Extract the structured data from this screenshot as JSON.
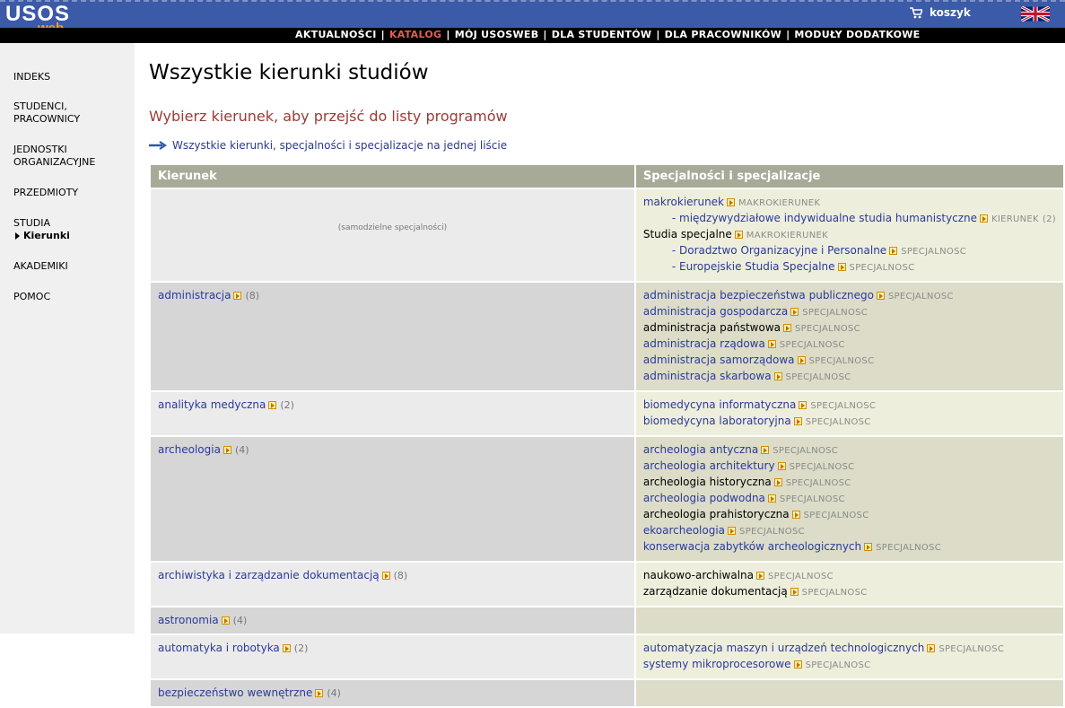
{
  "header": {
    "logo_main": "USOS",
    "logo_sub": "web",
    "cart_label": "koszyk",
    "menu": [
      {
        "label": "AKTUALNOŚCI",
        "active": false
      },
      {
        "label": "KATALOG",
        "active": true
      },
      {
        "label": "MÓJ USOSWEB",
        "active": false
      },
      {
        "label": "DLA STUDENTÓW",
        "active": false
      },
      {
        "label": "DLA PRACOWNIKÓW",
        "active": false
      },
      {
        "label": "MODUŁY DODATKOWE",
        "active": false
      }
    ],
    "menu_separator": "|"
  },
  "sidebar": {
    "items": [
      {
        "label": "INDEKS"
      },
      {
        "label": "STUDENCI,\nPRACOWNICY"
      },
      {
        "label": "JEDNOSTKI\nORGANIZACYJNE"
      },
      {
        "label": "PRZEDMIOTY"
      },
      {
        "label": "STUDIA"
      },
      {
        "label": "AKADEMIKI"
      },
      {
        "label": "POMOC"
      }
    ],
    "sub_item": "Kierunki"
  },
  "main": {
    "title": "Wszystkie kierunki studiów",
    "subtitle": "Wybierz kierunek, aby przejść do listy programów",
    "all_link": "Wszystkie kierunki, specjalności i specjalizacje na jednej liście",
    "table": {
      "headers": [
        "Kierunek",
        "Specjalności i specjalizacje"
      ],
      "rows": [
        {
          "kierunek": "",
          "note": "(samodzielne specjalności)",
          "count": "",
          "specs": [
            {
              "name": "makrokierunek",
              "link": true,
              "tag": "MAKROKIERUNEK",
              "indent": false,
              "extra": ""
            },
            {
              "name": "- międzywydziałowe indywidualne studia humanistyczne",
              "link": true,
              "tag": "KIERUNEK",
              "indent": true,
              "extra": "(2)"
            },
            {
              "name": "Studia specjalne",
              "link": false,
              "tag": "MAKROKIERUNEK",
              "indent": false,
              "extra": ""
            },
            {
              "name": "- Doradztwo Organizacyjne i Personalne",
              "link": true,
              "tag": "SPECJALNOSC",
              "indent": true,
              "extra": ""
            },
            {
              "name": "- Europejskie Studia Specjalne",
              "link": true,
              "tag": "SPECJALNOSC",
              "indent": true,
              "extra": ""
            }
          ]
        },
        {
          "kierunek": "administracja",
          "count": "(8)",
          "note": "",
          "specs": [
            {
              "name": "administracja bezpieczeństwa publicznego",
              "link": true,
              "tag": "SPECJALNOSC"
            },
            {
              "name": "administracja gospodarcza",
              "link": true,
              "tag": "SPECJALNOSC"
            },
            {
              "name": "administracja państwowa",
              "link": false,
              "tag": "SPECJALNOSC"
            },
            {
              "name": "administracja rządowa",
              "link": true,
              "tag": "SPECJALNOSC"
            },
            {
              "name": "administracja samorządowa",
              "link": true,
              "tag": "SPECJALNOSC"
            },
            {
              "name": "administracja skarbowa",
              "link": true,
              "tag": "SPECJALNOSC"
            }
          ]
        },
        {
          "kierunek": "analityka medyczna",
          "count": "(2)",
          "note": "",
          "specs": [
            {
              "name": "biomedycyna informatyczna",
              "link": true,
              "tag": "SPECJALNOSC"
            },
            {
              "name": "biomedycyna laboratoryjna",
              "link": true,
              "tag": "SPECJALNOSC"
            }
          ]
        },
        {
          "kierunek": "archeologia",
          "count": "(4)",
          "note": "",
          "specs": [
            {
              "name": "archeologia antyczna",
              "link": true,
              "tag": "SPECJALNOSC"
            },
            {
              "name": "archeologia architektury",
              "link": true,
              "tag": "SPECJALNOSC"
            },
            {
              "name": "archeologia historyczna",
              "link": false,
              "tag": "SPECJALNOSC"
            },
            {
              "name": "archeologia podwodna",
              "link": true,
              "tag": "SPECJALNOSC"
            },
            {
              "name": "archeologia prahistoryczna",
              "link": false,
              "tag": "SPECJALNOSC"
            },
            {
              "name": "ekoarcheologia",
              "link": true,
              "tag": "SPECJALNOSC"
            },
            {
              "name": "konserwacja zabytków archeologicznych",
              "link": true,
              "tag": "SPECJALNOSC"
            }
          ]
        },
        {
          "kierunek": "archiwistyka i zarządzanie dokumentacją",
          "count": "(8)",
          "note": "",
          "specs": [
            {
              "name": "naukowo-archiwalna",
              "link": false,
              "tag": "SPECJALNOSC"
            },
            {
              "name": "zarządzanie dokumentacją",
              "link": false,
              "tag": "SPECJALNOSC"
            }
          ]
        },
        {
          "kierunek": "astronomia",
          "count": "(4)",
          "note": "",
          "specs": []
        },
        {
          "kierunek": "automatyka i robotyka",
          "count": "(2)",
          "note": "",
          "specs": [
            {
              "name": "automatyzacja maszyn i urządzeń technologicznych",
              "link": true,
              "tag": "SPECJALNOSC"
            },
            {
              "name": "systemy mikroprocesorowe",
              "link": true,
              "tag": "SPECJALNOSC"
            }
          ]
        },
        {
          "kierunek": "bezpieczeństwo wewnętrzne",
          "count": "(4)",
          "note": "",
          "specs": []
        }
      ]
    }
  }
}
